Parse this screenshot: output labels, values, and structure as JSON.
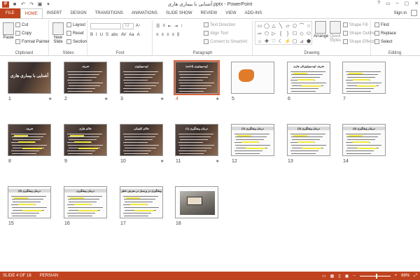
{
  "title_bar": {
    "app_icon": "P",
    "title": "آشنایی با بیماری هاری.pptx - PowerPoint",
    "qat": [
      "save-icon",
      "undo-icon",
      "redo-icon",
      "start-icon",
      "customize-icon"
    ],
    "qat_glyphs": [
      "■",
      "↶",
      "↷",
      "▣",
      "▾"
    ],
    "window_controls": [
      "?",
      "▭",
      "–",
      "▢",
      "✕"
    ]
  },
  "tabs": [
    "FILE",
    "HOME",
    "INSERT",
    "DESIGN",
    "TRANSITIONS",
    "ANIMATIONS",
    "SLIDE SHOW",
    "REVIEW",
    "VIEW",
    "ADD-INS"
  ],
  "active_tab": "HOME",
  "signin": "Sign in",
  "ribbon": {
    "clipboard": {
      "paste": "Paste",
      "cut": "Cut",
      "copy": "Copy",
      "format_painter": "Format Painter",
      "label": "Clipboard"
    },
    "slides": {
      "new_slide": "New Slide",
      "layout": "Layout",
      "reset": "Reset",
      "section": "Section",
      "label": "Slides"
    },
    "font": {
      "size": "72",
      "label": "Font",
      "buttons": [
        "B",
        "I",
        "U",
        "S",
        "abc",
        "AV",
        "Aa",
        "A"
      ]
    },
    "paragraph": {
      "text_direction": "Text Direction",
      "align_text": "Align Text",
      "convert_smartart": "Convert to SmartArt",
      "label": "Paragraph"
    },
    "drawing": {
      "arrange": "Arrange",
      "quick_styles": "Quick Styles",
      "shape_fill": "Shape Fill",
      "shape_outline": "Shape Outline",
      "shape_effects": "Shape Effects",
      "label": "Drawing",
      "shape_glyphs": [
        "▭",
        "◯",
        "△",
        "╲",
        "▱",
        "⬠",
        "⌒",
        "☆",
        "⇨",
        "⬡",
        "▷",
        "{",
        "}",
        "☐",
        "◇",
        "⬭",
        "⌂",
        "✚",
        "♡",
        "☾",
        "⚡",
        "▢",
        "⊿",
        "⬟"
      ]
    },
    "editing": {
      "find": "Find",
      "replace": "Replace",
      "select": "Select",
      "label": "Editing"
    }
  },
  "slides": [
    {
      "number": "1",
      "title": "آشنایی با بیماری هاری",
      "star": true
    },
    {
      "number": "2",
      "title": "تعریف",
      "star": true
    },
    {
      "number": "3",
      "title": "اپیدمیولوژی",
      "star": true
    },
    {
      "number": "4",
      "title": "اپیدمیولوژی (ادامه)",
      "star": true
    },
    {
      "number": "5",
      "title": "",
      "star": false
    },
    {
      "number": "6",
      "title": "تعریف اپیدمیولوژیکی هاری",
      "star": false
    },
    {
      "number": "7",
      "title": "",
      "star": false
    },
    {
      "number": "8",
      "title": "تعریف",
      "star": false
    },
    {
      "number": "9",
      "title": "علائم هاری",
      "star": false
    },
    {
      "number": "10",
      "title": "علائم کلینیکی",
      "star": true
    },
    {
      "number": "11",
      "title": "درمان پیشگیری (1)",
      "star": true
    },
    {
      "number": "12",
      "title": "درمان پیشگیری (2)",
      "star": false
    },
    {
      "number": "13",
      "title": "درمان پیشگیری (3)",
      "star": false
    },
    {
      "number": "14",
      "title": "درمان پیشگیری (4)",
      "star": false
    },
    {
      "number": "15",
      "title": "درمان پیشگیری (5)",
      "star": false
    },
    {
      "number": "16",
      "title": "درمان پیشگیری",
      "star": false
    },
    {
      "number": "17",
      "title": "پیشگیری در پرسنل در معرض خطر",
      "star": false
    },
    {
      "number": "18",
      "title": "",
      "star": false
    }
  ],
  "selected_slide": "4",
  "status_bar": {
    "slide_info": "SLIDE 4 OF 18",
    "language": "PERSIAN",
    "zoom": "68%",
    "zoom_fraction": 0.52
  },
  "colors": {
    "accent": "#c0431f",
    "selection": "#d7613a",
    "highlight": "#f3e83a"
  }
}
